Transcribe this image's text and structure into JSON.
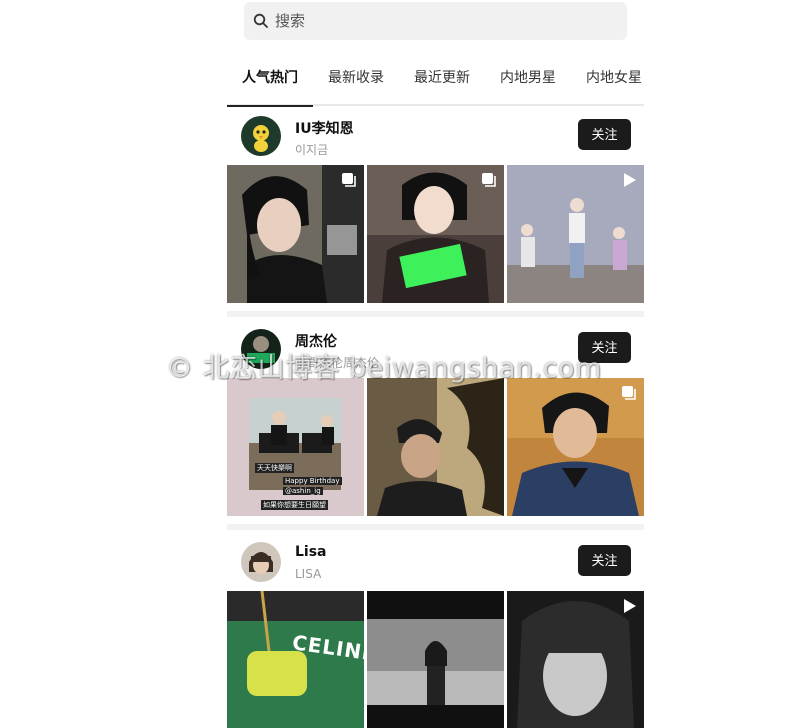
{
  "search": {
    "placeholder": "搜索"
  },
  "tabs": [
    "人气热门",
    "最新收录",
    "最近更新",
    "内地男星",
    "内地女星"
  ],
  "active_tab": "人气热门",
  "sections": [
    {
      "name": "IU李知恩",
      "subtitle": "이지금",
      "follow_label": "关注"
    },
    {
      "name": "周杰伦",
      "subtitle": "小哥杰伦周杰伦",
      "follow_label": "关注",
      "tile_captions": {
        "caption_1": "天天快樂啊",
        "caption_2": "Happy Birthday",
        "caption_3": "@ashin_ig",
        "caption_4": "如果你想要生日願望"
      }
    },
    {
      "name": "Lisa",
      "subtitle": "LISA",
      "follow_label": "关注"
    }
  ],
  "watermark": "© 北恋山博客 beiwangshan.com",
  "colors": {
    "follow_bg": "#1b1b1b",
    "separator": "#f2f2f2",
    "tab_underline": "#222222"
  },
  "icons": {
    "search": "magnifier-icon",
    "multi_photo": "stacked-photos-icon",
    "video": "play-icon"
  }
}
